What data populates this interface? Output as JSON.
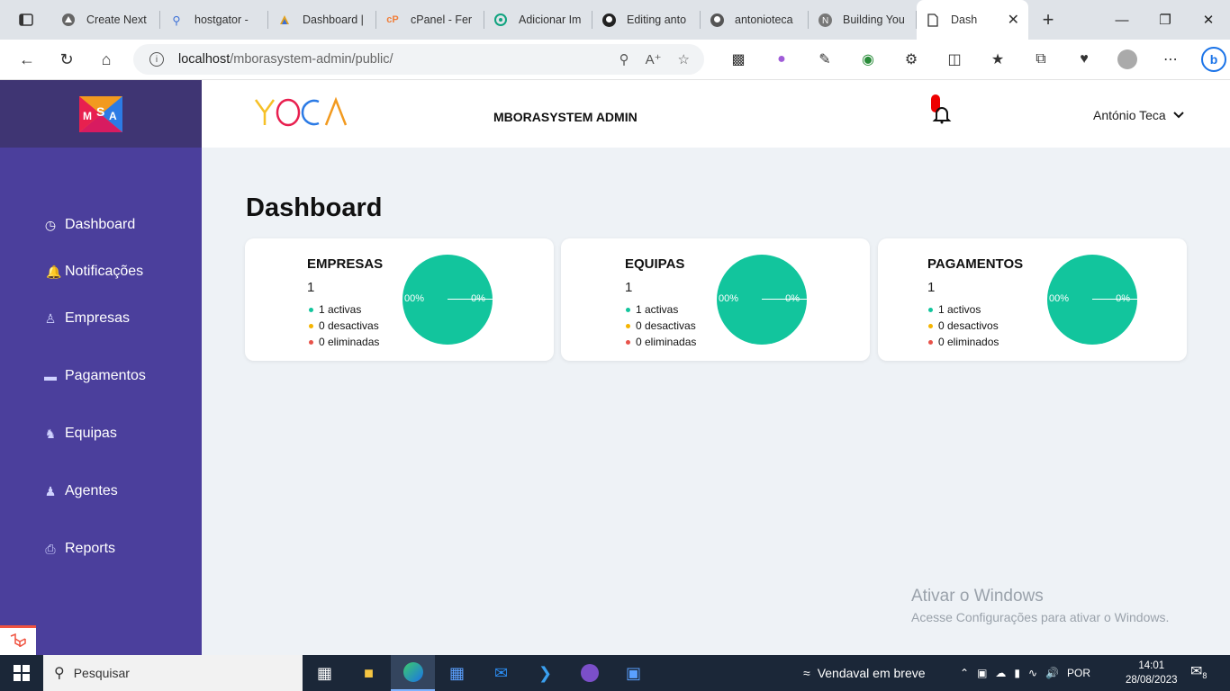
{
  "browser": {
    "tabs": [
      {
        "title": "Create Next",
        "icon": "triangle-icon"
      },
      {
        "title": "hostgator - ",
        "icon": "search-icon"
      },
      {
        "title": "Dashboard |",
        "icon": "grid-icon"
      },
      {
        "title": "cPanel - Fer",
        "icon": "cpanel-icon"
      },
      {
        "title": "Adicionar Im",
        "icon": "openai-icon"
      },
      {
        "title": "Editing anto",
        "icon": "github-icon"
      },
      {
        "title": "antonioteca",
        "icon": "github-icon"
      },
      {
        "title": "Building You",
        "icon": "n-icon"
      },
      {
        "title": "Dash",
        "icon": "page-icon",
        "active": true
      }
    ],
    "url_host": "localhost",
    "url_path": "/mborasystem-admin/public/"
  },
  "sidebar": {
    "items": [
      {
        "label": "Dashboard",
        "icon": "gauge-icon"
      },
      {
        "label": "Notificações",
        "icon": "bell-icon"
      },
      {
        "label": "Empresas",
        "icon": "users-icon"
      },
      {
        "label": "Pagamentos",
        "icon": "card-icon"
      },
      {
        "label": "Equipas",
        "icon": "team-icon"
      },
      {
        "label": "Agentes",
        "icon": "agents-icon"
      },
      {
        "label": "Reports",
        "icon": "printer-icon"
      }
    ]
  },
  "header": {
    "brand": "MBORASYSTEM ADMIN",
    "user": "António Teca"
  },
  "main": {
    "title": "Dashboard",
    "cards": [
      {
        "title": "EMPRESAS",
        "count": "1",
        "active": "1 activas",
        "inactive": "0 desactivas",
        "deleted": "0 eliminadas",
        "pie_left": "00%",
        "pie_right": "0%"
      },
      {
        "title": "EQUIPAS",
        "count": "1",
        "active": "1 activas",
        "inactive": "0 desactivas",
        "deleted": "0 eliminadas",
        "pie_left": "00%",
        "pie_right": "0%"
      },
      {
        "title": "PAGAMENTOS",
        "count": "1",
        "active": "1 activos",
        "inactive": "0 desactivos",
        "deleted": "0 eliminados",
        "pie_left": "00%",
        "pie_right": "0%"
      }
    ],
    "colors": {
      "pie": "#12c59d",
      "active": "#12c59d",
      "inactive": "#f5b400",
      "deleted": "#e8534a"
    }
  },
  "watermark": {
    "line1": "Ativar o Windows",
    "line2": "Acesse Configurações para ativar o Windows."
  },
  "taskbar": {
    "search": "Pesquisar",
    "weather": "Vendaval em breve",
    "lang": "POR",
    "time": "14:01",
    "date": "28/08/2023",
    "notifications": "8"
  }
}
